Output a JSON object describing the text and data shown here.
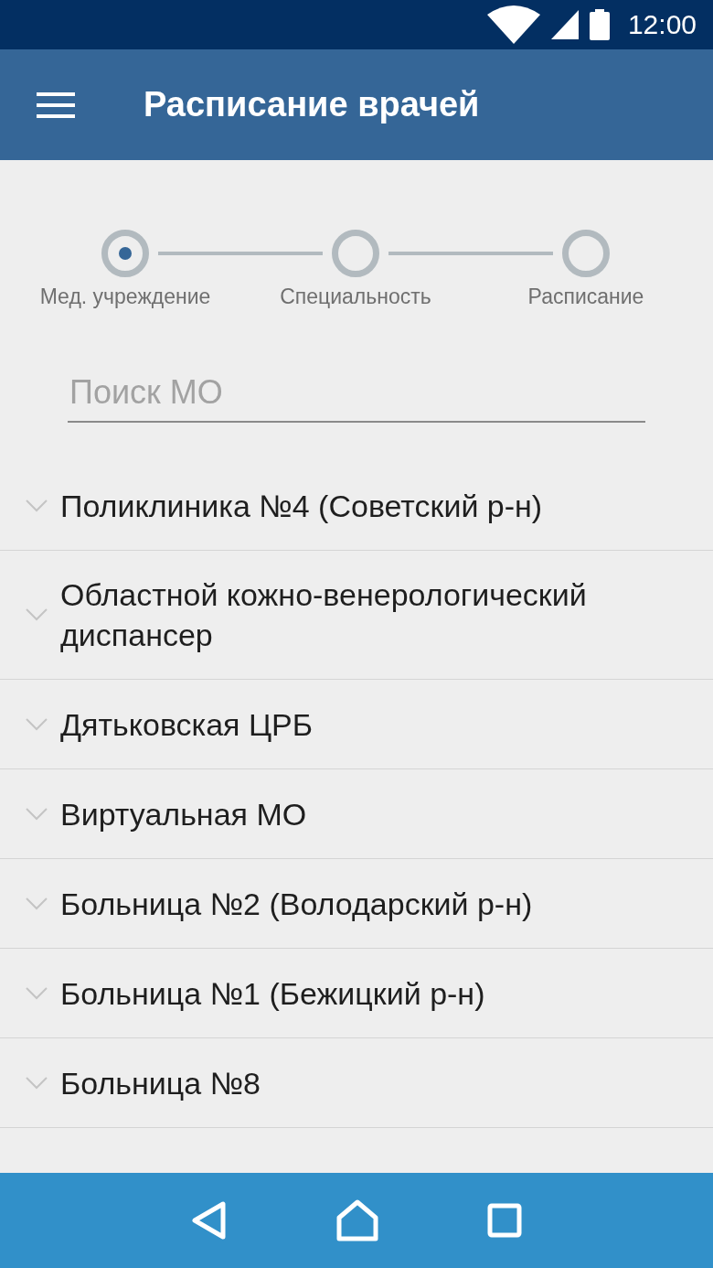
{
  "status_bar": {
    "time": "12:00"
  },
  "toolbar": {
    "title": "Расписание врачей"
  },
  "steps": [
    {
      "label": "Мед. учреждение",
      "selected": true
    },
    {
      "label": "Специальность",
      "selected": false
    },
    {
      "label": "Расписание",
      "selected": false
    }
  ],
  "search": {
    "placeholder": "Поиск МО"
  },
  "clinics": [
    {
      "name": "Поликлиника №4 (Советский р-н)",
      "expanded": false
    },
    {
      "name": "Областной кожно-венерологический диспансер",
      "expanded": false
    },
    {
      "name": "Дятьковская ЦРБ",
      "expanded": false
    },
    {
      "name": "Виртуальная МО",
      "expanded": false
    },
    {
      "name": "Больница №2 (Володарский р-н)",
      "expanded": false
    },
    {
      "name": "Больница №1 (Бежицкий р-н)",
      "expanded": false
    },
    {
      "name": "Больница №8",
      "expanded": false
    }
  ]
}
